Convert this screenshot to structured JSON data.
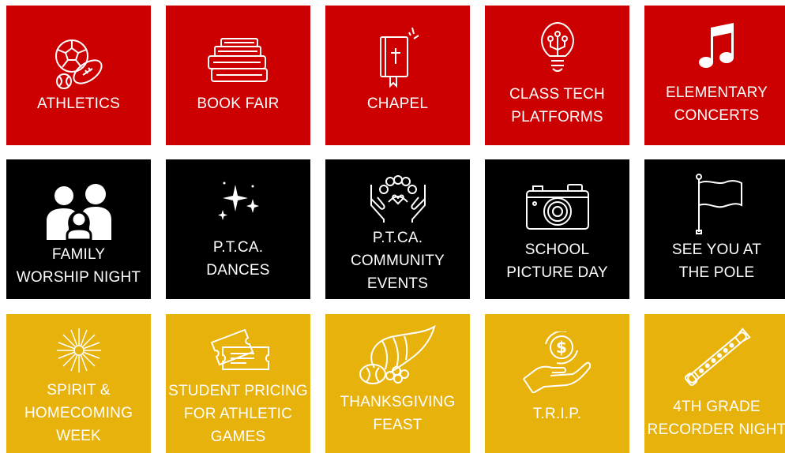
{
  "tiles": [
    {
      "label": "ATHLETICS",
      "icon": "sports-balls-icon",
      "color": "#cc0000"
    },
    {
      "label": "BOOK FAIR",
      "icon": "books-stack-icon",
      "color": "#cc0000"
    },
    {
      "label": "CHAPEL",
      "icon": "bible-icon",
      "color": "#cc0000"
    },
    {
      "label": "CLASS TECH\nPLATFORMS",
      "icon": "lightbulb-circuit-icon",
      "color": "#cc0000"
    },
    {
      "label": "ELEMENTARY\nCONCERTS",
      "icon": "music-note-icon",
      "color": "#cc0000"
    },
    {
      "label": "FAMILY\nWORSHIP NIGHT",
      "icon": "family-icon",
      "color": "#000000"
    },
    {
      "label": "P.T.CA.\nDANCES",
      "icon": "sparkles-icon",
      "color": "#000000"
    },
    {
      "label": "P.T.CA.\nCOMMUNITY\nEVENTS",
      "icon": "community-hands-icon",
      "color": "#000000"
    },
    {
      "label": "SCHOOL\nPICTURE DAY",
      "icon": "camera-icon",
      "color": "#000000"
    },
    {
      "label": "SEE YOU AT\nTHE POLE",
      "icon": "flag-pole-icon",
      "color": "#000000"
    },
    {
      "label": "SPIRIT &\nHOMECOMING\nWEEK",
      "icon": "pom-pom-icon",
      "color": "#e8b20c"
    },
    {
      "label": "STUDENT PRICING\nFOR ATHLETIC\nGAMES",
      "icon": "tickets-icon",
      "color": "#e8b20c"
    },
    {
      "label": "THANKSGIVING\nFEAST",
      "icon": "cornucopia-icon",
      "color": "#e8b20c"
    },
    {
      "label": "T.R.I.P.",
      "icon": "money-hand-icon",
      "color": "#e8b20c"
    },
    {
      "label": "4TH GRADE\nRECORDER NIGHT",
      "icon": "recorder-flute-icon",
      "color": "#e8b20c"
    }
  ]
}
